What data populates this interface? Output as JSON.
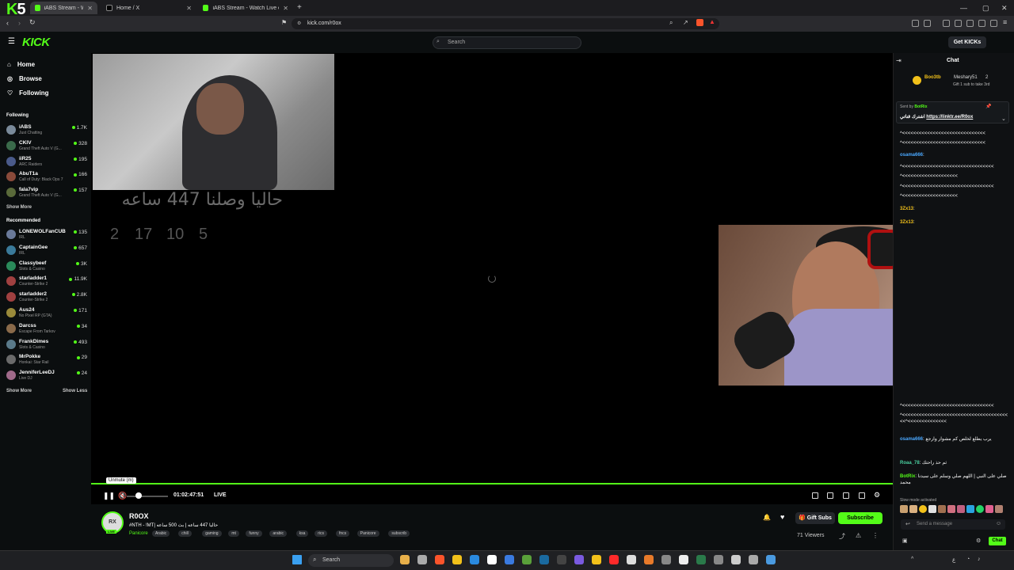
{
  "browser": {
    "tabs": [
      {
        "title": "iABS Stream - Watch Live on Kick"
      },
      {
        "title": "Home / X"
      },
      {
        "title": "iABS Stream - Watch Live on Kick"
      }
    ],
    "overlay_logo": {
      "k": "K",
      "num": "5"
    },
    "url": "kick.com/r0ox",
    "accent": "#53fc18"
  },
  "header": {
    "logo": "KICK",
    "search_placeholder": "Search",
    "get_kicks": "Get KICKs"
  },
  "sidebar": {
    "nav": [
      {
        "label": "Home",
        "icon": "home-icon"
      },
      {
        "label": "Browse",
        "icon": "compass-icon"
      },
      {
        "label": "Following",
        "icon": "heart-icon"
      }
    ],
    "following_title": "Following",
    "following": [
      {
        "name": "iABS",
        "game": "Just Chatting",
        "viewers": "1.7K"
      },
      {
        "name": "CKIV",
        "game": "Grand Theft Auto V (G...",
        "viewers": "328"
      },
      {
        "name": "iiR25",
        "game": "ARC Raiders",
        "viewers": "195"
      },
      {
        "name": "AbuT1a",
        "game": "Call of Duty: Black Ops 7",
        "viewers": "166"
      },
      {
        "name": "fala7vip",
        "game": "Grand Theft Auto V (G...",
        "viewers": "157"
      }
    ],
    "show_more": "Show More",
    "recommended_title": "Recommended",
    "recommended": [
      {
        "name": "LONEWOLFanCUB",
        "game": "IRL",
        "viewers": "135"
      },
      {
        "name": "CaptainGee",
        "game": "IRL",
        "viewers": "657"
      },
      {
        "name": "Classybeef",
        "game": "Slots & Casino",
        "viewers": "3K"
      },
      {
        "name": "starladder1",
        "game": "Counter-Strike 2",
        "viewers": "11.9K"
      },
      {
        "name": "starladder2",
        "game": "Counter-Strike 2",
        "viewers": "2.8K"
      },
      {
        "name": "Aus24",
        "game": "No Pixel RP (GTA)",
        "viewers": "171"
      },
      {
        "name": "Darcss",
        "game": "Escape From Tarkov",
        "viewers": "34"
      },
      {
        "name": "FrankDimes",
        "game": "Slots & Casino",
        "viewers": "493"
      },
      {
        "name": "MrPokke",
        "game": "Honkai: Star Rail",
        "viewers": "29"
      },
      {
        "name": "JenniferLeeDJ",
        "game": "Live DJ",
        "viewers": "24"
      }
    ],
    "show_more2": "Show More",
    "show_less": "Show Less"
  },
  "player": {
    "overlay_text": "حاليا وصلنا 447 ساعه",
    "countdown": [
      "2",
      "17",
      "10",
      "5"
    ],
    "tooltip": "Unmute (m)",
    "time": "01:02:47:51",
    "live": "LIVE"
  },
  "stream": {
    "channel": "R0OX",
    "avatar_text": "RX",
    "live_badge": "LIVE",
    "title": "#NTH - !MT| حاليا 447 ساعه | بث 500 ساعه",
    "category": "Panicore",
    "tags": [
      "Arabic",
      "chill",
      "gaming",
      "mt",
      "funny",
      "arabic",
      "ksa",
      "rics",
      "fncs",
      "Panicore",
      "subscrib"
    ],
    "gift_subs": "Gift Subs",
    "subscribe": "Subscribe",
    "viewers": "71 Viewers"
  },
  "chat": {
    "title": "Chat",
    "leaderboard": {
      "first": "Boo3tb",
      "second": "Meshary51",
      "second_count": "2",
      "gift_text": "Gift 1 sub to take 3rd"
    },
    "pinned": {
      "by": "Sent by",
      "user": "BotRix",
      "text": "اشترك قناتي",
      "link": "https://linktr.ee/R0ox"
    },
    "messages": [
      {
        "user": "",
        "text": "^<<<<<<<<<<<<<<<<<<<<<<<<<<<<<<"
      },
      {
        "user": "",
        "text": "^<<<<<<<<<<<<<<<<<<<<<<<<<<<<<<"
      },
      {
        "user": "osama666",
        "text": ""
      },
      {
        "user": "",
        "text": "^<<<<<<<<<<<<<<<<<<<<<<<<<<<<<<<<<"
      },
      {
        "user": "",
        "text": "^<<<<<<<<<<<<<<<<<<<<"
      },
      {
        "user": "",
        "text": "^<<<<<<<<<<<<<<<<<<<<<<<<<<<<<<<<<"
      },
      {
        "user": "",
        "text": "^<<<<<<<<<<<<<<<<<<<<"
      },
      {
        "user": "3Zx13",
        "text": ""
      },
      {
        "user": "3Zx13",
        "text": ""
      },
      {
        "user": "",
        "text": "^<<<<<<<<<<<<<<<<<<<<<<<<<<<<<<<<<"
      },
      {
        "user": "",
        "text": "^<<<<<<<<<<<<<<<<<<<<<<<<<<<<<<<<<<<<<<<<^<<<<<<<<<<<<<<"
      },
      {
        "user": "osama666",
        "text": "يرب يطلع لخلص كم مشوار وارجع"
      },
      {
        "user": "Roaa_78",
        "text": "ثم حذ راحتك"
      },
      {
        "user": "BotRix",
        "text": "صلي على النبي | اللهم صلي وسلم على سيدنا محمد"
      }
    ],
    "slow_mode": "Slow mode activated",
    "send_placeholder": "Send a message",
    "chat_button": "Chat"
  },
  "taskbar": {
    "search": "Search"
  }
}
